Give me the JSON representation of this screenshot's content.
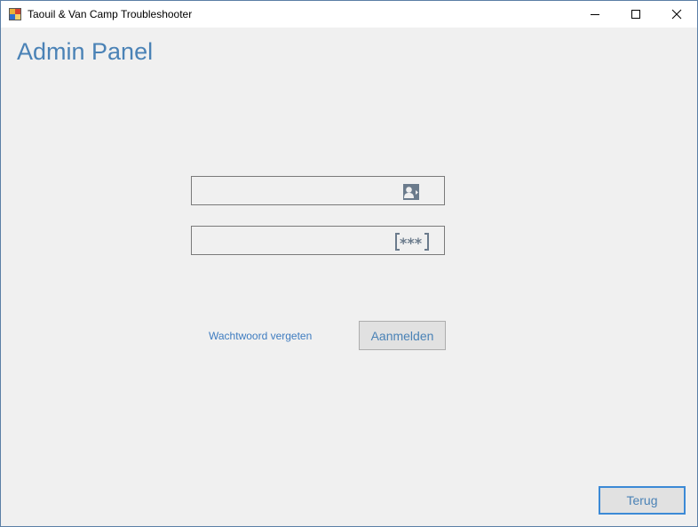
{
  "window": {
    "title": "Taouil & Van Camp Troubleshooter",
    "controls": {
      "minimize": "minimize-icon",
      "maximize": "maximize-icon",
      "close": "close-icon"
    }
  },
  "main": {
    "title": "Admin Panel",
    "username": {
      "value": "",
      "placeholder": "",
      "icon": "user-card-icon"
    },
    "password": {
      "value": "",
      "placeholder": "",
      "icon": "password-dots-icon"
    },
    "forgot_link": "Wachtwoord vergeten",
    "login_label": "Aanmelden"
  },
  "footer": {
    "back_label": "Terug"
  },
  "colors": {
    "accent": "#4a82b6",
    "link": "#3e7cc0",
    "focus_border": "#3c8ad6",
    "background": "#f0f0f0",
    "icon": "#6b7b8c"
  }
}
